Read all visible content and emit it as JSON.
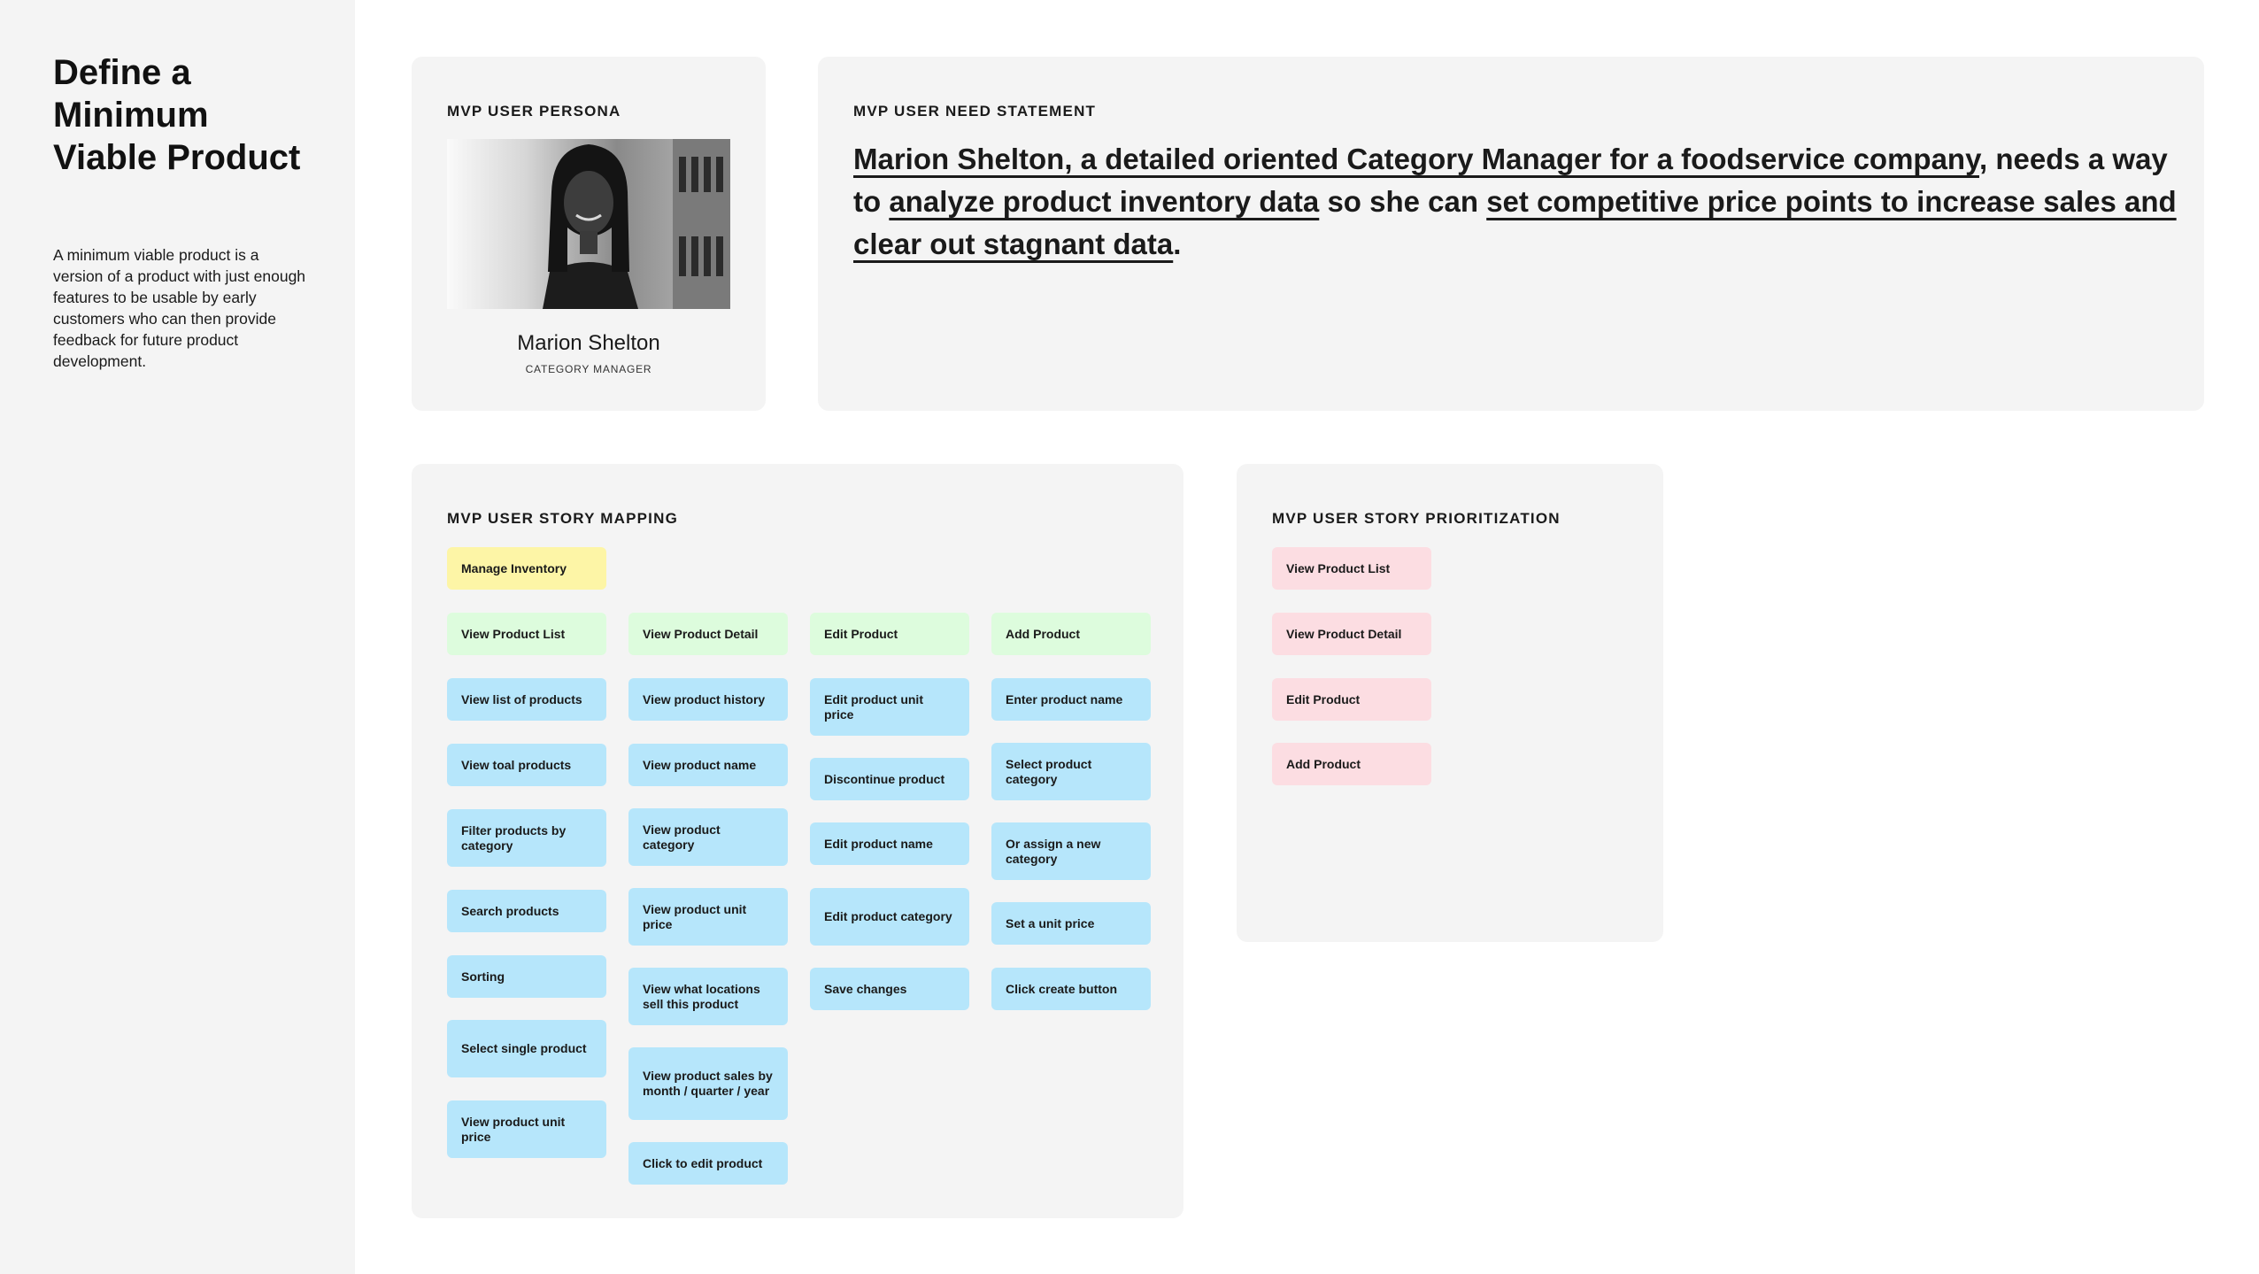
{
  "sidebar": {
    "title": "Define a Minimum Viable Product",
    "description": "A minimum viable product is a version of a product with just enough features to be usable by early customers who can then provide feedback for future product development."
  },
  "persona": {
    "heading": "MVP USER PERSONA",
    "name": "Marion Shelton",
    "role": "CATEGORY MANAGER"
  },
  "need_statement": {
    "heading": "MVP USER NEED STATEMENT",
    "parts": [
      "Marion Shelton, a detailed oriented Category Manager for a foodservice company",
      ", ",
      "needs a way to ",
      "analyze product inventory data",
      " so she can ",
      "set competitive price points to increase sales and clear out stagnant data",
      "."
    ]
  },
  "story_mapping": {
    "heading": "MVP USER STORY MAPPING",
    "epic": "Manage Inventory",
    "columns": [
      {
        "header": "View Product List",
        "stories": [
          "View list of products",
          "View toal products",
          "Filter products by category",
          "Search products",
          "Sorting",
          "Select single product",
          "View product unit price"
        ]
      },
      {
        "header": "View Product Detail",
        "stories": [
          "View product history",
          "View product name",
          "View product category",
          "View product unit price",
          "View what locations sell this product",
          "View product sales by month / quarter / year",
          "Click to edit product"
        ]
      },
      {
        "header": "Edit Product",
        "stories": [
          "Edit product unit price",
          "Discontinue product",
          "Edit product name",
          "Edit product category",
          "Save changes"
        ]
      },
      {
        "header": "Add Product",
        "stories": [
          "Enter product name",
          "Select product category",
          "Or assign a new category",
          "Set a unit price",
          "Click create button"
        ]
      }
    ]
  },
  "prioritization": {
    "heading": "MVP USER STORY PRIORITIZATION",
    "items": [
      "View Product List",
      "View Product Detail",
      "Edit Product",
      "Add Product"
    ]
  },
  "colors": {
    "panel": "#f4f4f4",
    "epic": "#fdf5a6",
    "activity": "#ddfcdd",
    "story": "#b6e6fb",
    "priority": "#fcdde2"
  }
}
